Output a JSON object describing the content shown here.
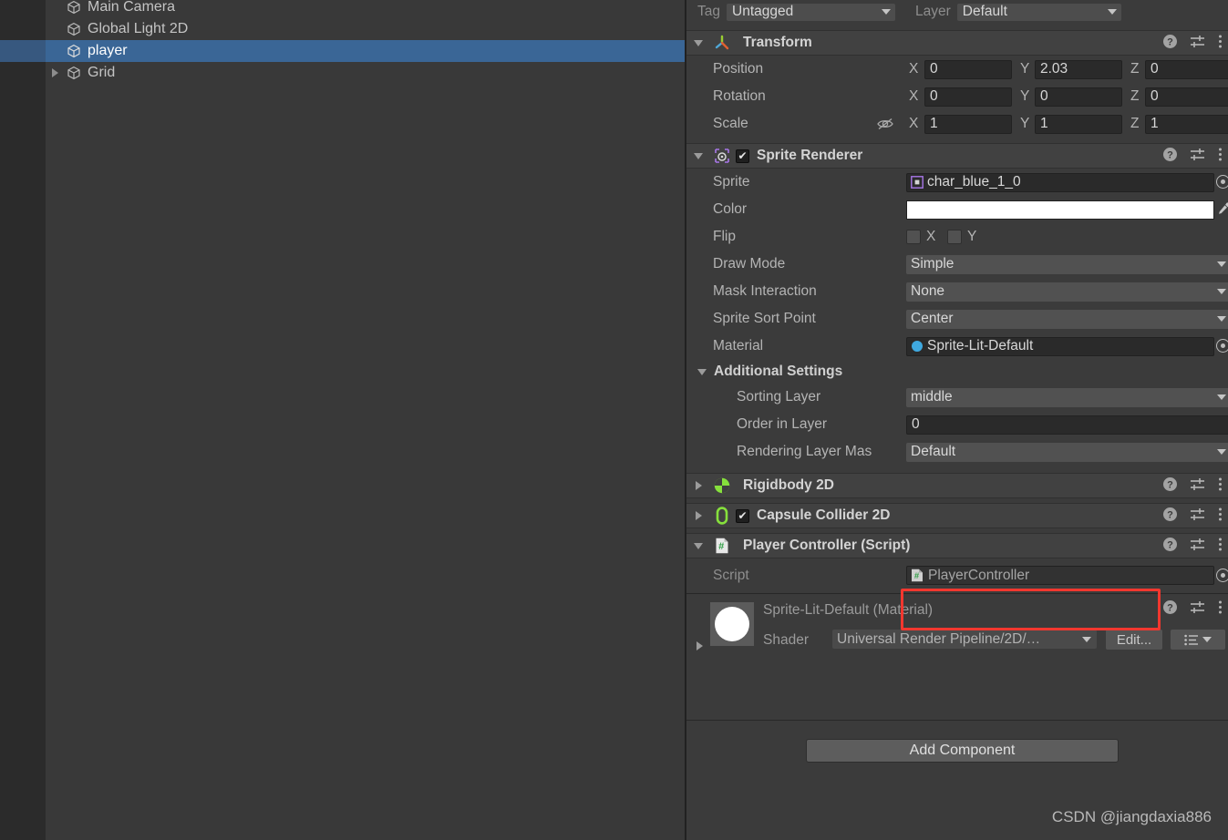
{
  "hierarchy": {
    "items": [
      {
        "label": "Main Camera",
        "icon": "cube-icon",
        "expandable": false,
        "selected": false
      },
      {
        "label": "Global Light 2D",
        "icon": "cube-icon",
        "expandable": false,
        "selected": false
      },
      {
        "label": "player",
        "icon": "cube-icon",
        "expandable": false,
        "selected": true
      },
      {
        "label": "Grid",
        "icon": "cube-icon",
        "expandable": true,
        "selected": false
      }
    ],
    "selection_color": "#3a6696"
  },
  "inspector": {
    "tag_label": "Tag",
    "tag_value": "Untagged",
    "layer_label": "Layer",
    "layer_value": "Default",
    "transform": {
      "title": "Transform",
      "rows": [
        {
          "label": "Position",
          "x": "0",
          "y": "2.03",
          "z": "0"
        },
        {
          "label": "Rotation",
          "x": "0",
          "y": "0",
          "z": "0"
        },
        {
          "label": "Scale",
          "x": "1",
          "y": "1",
          "z": "1"
        }
      ],
      "axis_x": "X",
      "axis_y": "Y",
      "axis_z": "Z"
    },
    "sprite_renderer": {
      "title": "Sprite Renderer",
      "enabled": true,
      "sprite_label": "Sprite",
      "sprite_value": "char_blue_1_0",
      "color_label": "Color",
      "color_value": "#ffffff",
      "flip_label": "Flip",
      "flip_x_label": "X",
      "flip_y_label": "Y",
      "draw_mode_label": "Draw Mode",
      "draw_mode_value": "Simple",
      "mask_interaction_label": "Mask Interaction",
      "mask_interaction_value": "None",
      "sprite_sort_point_label": "Sprite Sort Point",
      "sprite_sort_point_value": "Center",
      "material_label": "Material",
      "material_value": "Sprite-Lit-Default",
      "additional_settings_title": "Additional Settings",
      "sorting_layer_label": "Sorting Layer",
      "sorting_layer_value": "middle",
      "order_in_layer_label": "Order in Layer",
      "order_in_layer_value": "0",
      "rendering_layer_mask_label": "Rendering Layer Mas",
      "rendering_layer_mask_value": "Default"
    },
    "rigidbody2d": {
      "title": "Rigidbody 2D",
      "expanded": false
    },
    "capsule_collider2d": {
      "title": "Capsule Collider 2D",
      "expanded": false,
      "enabled": true
    },
    "player_controller": {
      "title": "Player Controller (Script)",
      "script_label": "Script",
      "script_value": "PlayerController",
      "highlight_color": "#f2372f"
    },
    "material_preview": {
      "title": "Sprite-Lit-Default (Material)",
      "shader_label": "Shader",
      "shader_value": "Universal Render Pipeline/2D/…",
      "edit_button": "Edit...",
      "swatch_color": "#ffffff"
    },
    "add_component_button": "Add Component",
    "watermark": "CSDN @jiangdaxia886"
  }
}
